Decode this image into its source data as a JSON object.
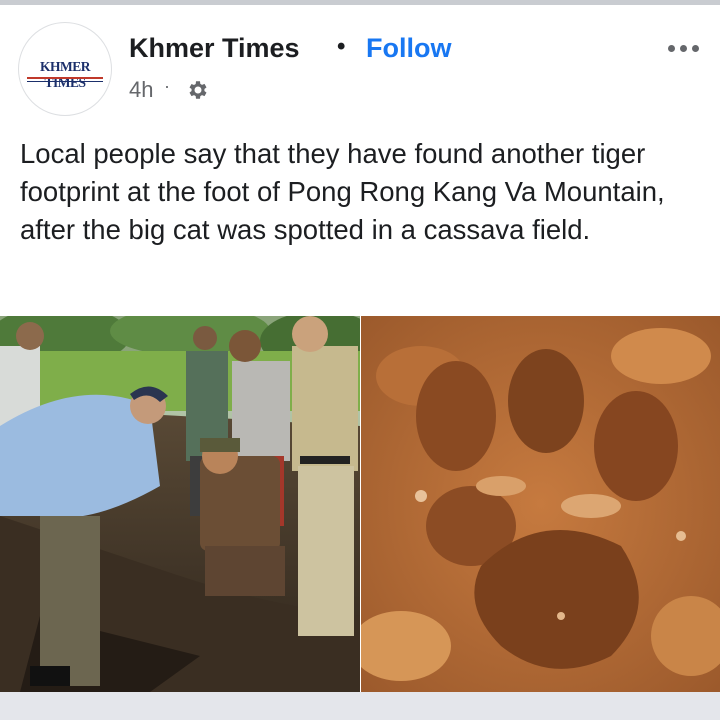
{
  "post": {
    "page_name": "Khmer Times",
    "separator": "•",
    "follow_label": "Follow",
    "time": "4h",
    "time_separator": "·",
    "audience_icon": "gear-icon",
    "more_icon": "more-options-icon",
    "avatar_logo_text": "KHMER TIMES",
    "caption": "Local people say that they have found another tiger footprint at the foot of Pong Rong Kang Va Mountain, after the big cat was spotted in a cassava field.",
    "images": [
      {
        "name": "officials-inspecting-footprint-photo"
      },
      {
        "name": "tiger-footprint-closeup-photo"
      }
    ]
  },
  "colors": {
    "follow": "#1877f2",
    "secondary_text": "#65676b",
    "primary_text": "#1c1e21"
  }
}
